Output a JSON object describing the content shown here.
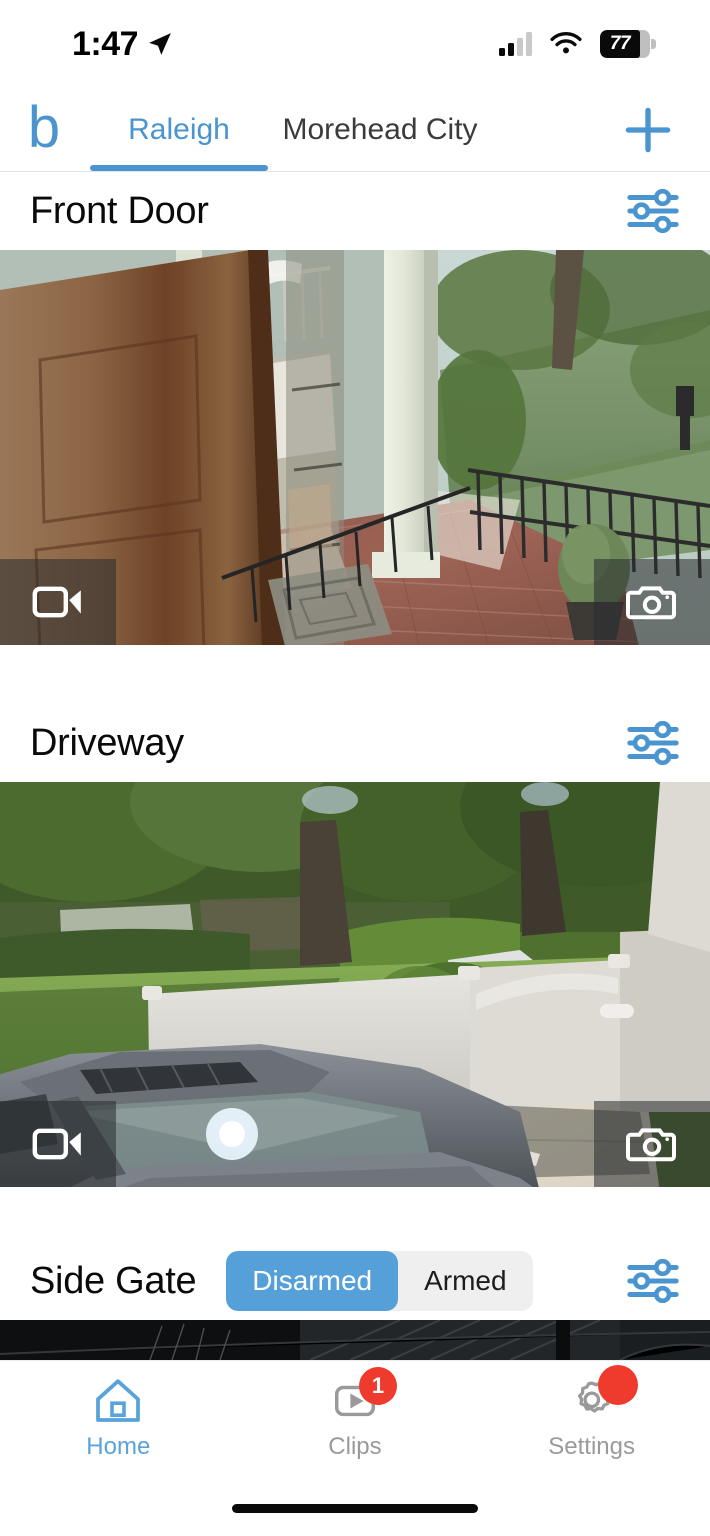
{
  "status_bar": {
    "time": "1:47",
    "location_icon": "location-arrow-icon",
    "cellular_icon": "cellular-signal-icon",
    "wifi_icon": "wifi-icon",
    "battery_percent": "77"
  },
  "nav": {
    "brand": "b",
    "add_label": "+",
    "tabs": [
      {
        "label": "Raleigh",
        "active": true
      },
      {
        "label": "Morehead City",
        "active": false
      }
    ]
  },
  "cameras": [
    {
      "name": "Front Door",
      "settings_icon": "sliders-icon",
      "record_icon": "video-camera-icon",
      "snapshot_icon": "photo-camera-icon"
    },
    {
      "name": "Driveway",
      "settings_icon": "sliders-icon",
      "record_icon": "video-camera-icon",
      "snapshot_icon": "photo-camera-icon"
    },
    {
      "name": "Side Gate",
      "settings_icon": "sliders-icon",
      "arm_control": {
        "options": [
          "Disarmed",
          "Armed"
        ],
        "selected": "Disarmed"
      }
    }
  ],
  "bottom_tabs": [
    {
      "label": "Home",
      "icon": "house-icon",
      "active": true,
      "badge": ""
    },
    {
      "label": "Clips",
      "icon": "play-square-icon",
      "active": false,
      "badge": "1"
    },
    {
      "label": "Settings",
      "icon": "gear-icon",
      "active": false,
      "badge": ""
    }
  ],
  "colors": {
    "accent": "#4a94cf",
    "segment_on": "#55a0d8",
    "badge": "#ef3b2d",
    "inactive_text": "#9a9a9a"
  }
}
